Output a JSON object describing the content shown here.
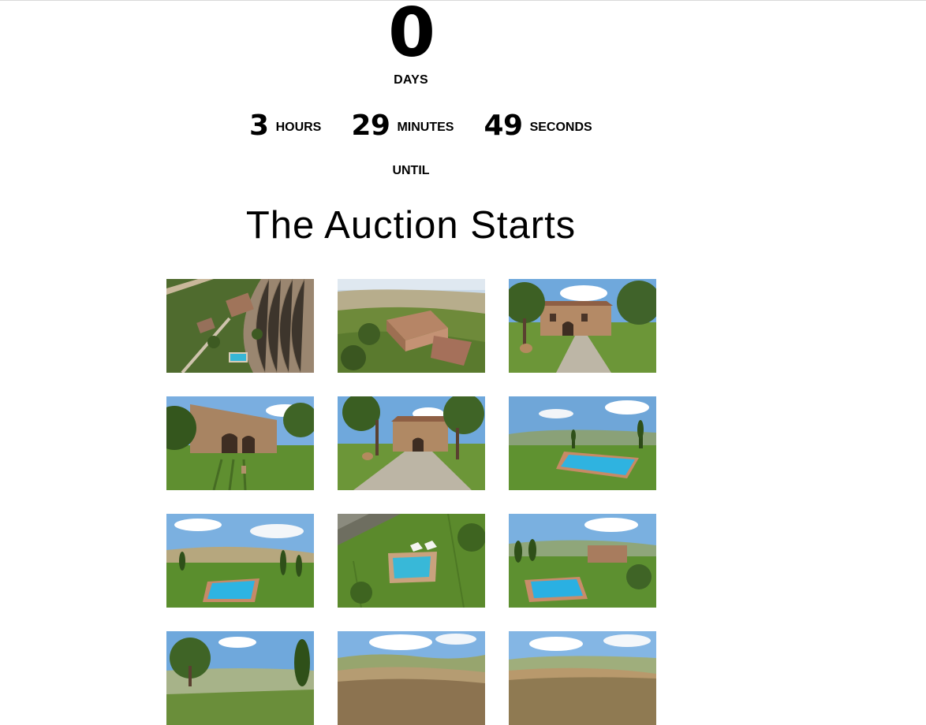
{
  "countdown": {
    "days": {
      "value": "0",
      "label": "DAYS"
    },
    "hours": {
      "value": "3",
      "label": "HOURS"
    },
    "minutes": {
      "value": "29",
      "label": "MINUTES"
    },
    "seconds": {
      "value": "49",
      "label": "SECONDS"
    },
    "until_label": "UNTIL",
    "event_title": "The Auction Starts"
  },
  "gallery": {
    "photos": [
      {
        "name": "photo-aerial-farmhouse-fields",
        "scene": "aerial-top"
      },
      {
        "name": "photo-aerial-villa-hills",
        "scene": "aerial-villa"
      },
      {
        "name": "photo-villa-front-driveway",
        "scene": "villa-front"
      },
      {
        "name": "photo-villa-lawn-trees",
        "scene": "villa-lawn"
      },
      {
        "name": "photo-villa-gravel-path",
        "scene": "villa-path"
      },
      {
        "name": "photo-pool-hills-cypress",
        "scene": "pool-landscape"
      },
      {
        "name": "photo-pool-panorama",
        "scene": "pool-panorama"
      },
      {
        "name": "photo-aerial-pool-garden",
        "scene": "aerial-pool"
      },
      {
        "name": "photo-pool-villa-view",
        "scene": "pool-villa"
      },
      {
        "name": "photo-countryside-tree",
        "scene": "country-tree"
      },
      {
        "name": "photo-rolling-hills",
        "scene": "hills"
      },
      {
        "name": "photo-valley-panorama",
        "scene": "valley"
      }
    ]
  }
}
